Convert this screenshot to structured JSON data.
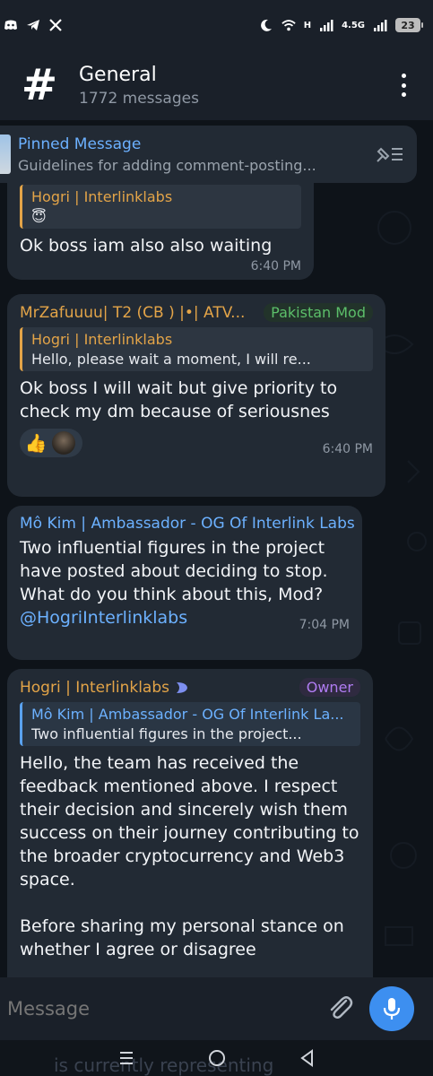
{
  "status_bar": {
    "icons": [
      "discord-icon",
      "telegram-icon",
      "x-icon"
    ],
    "right_icons": [
      "moon-icon",
      "wifi-icon",
      "signal-icon",
      "signal-4g-icon"
    ],
    "net_h": "H",
    "net_4g": "4.5G",
    "battery": "23"
  },
  "header": {
    "title": "General",
    "subtitle": "1772 messages",
    "icon": "hash-icon"
  },
  "pinned": {
    "title": "Pinned Message",
    "text": "Guidelines for adding comment-posting..."
  },
  "messages": [
    {
      "reply_name": "Hogri | Interlinklabs",
      "reply_emoji": "😇",
      "text": "Ok boss iam also also waiting",
      "time": "6:40 PM"
    },
    {
      "author": "MrZafuuuu| T2 (CB ) |•| ATV...",
      "badge": "Pakistan Mod",
      "reply_name": "Hogri | Interlinklabs",
      "reply_text": "Hello, please wait a moment, I will re...",
      "text": "Ok boss I will wait but give priority to check my dm because of seriousnes",
      "reaction": "👍",
      "time": "6:40 PM"
    },
    {
      "author": "Mô Kim | Ambassador - OG Of Interlink Labs",
      "text": "Two influential figures in the project have posted about deciding to stop. What do you think about this, Mod?",
      "mention": "@HogriInterlinklabs",
      "time": "7:04 PM"
    },
    {
      "author": "Hogri | Interlinklabs",
      "badge": "Owner",
      "reply_name": "Mô Kim | Ambassador - OG Of Interlink La...",
      "reply_text": "Two influential figures in the project...",
      "text": "Hello, the team has received the feedback mentioned above. I respect their decision and sincerely wish them success on their journey contributing to the broader cryptocurrency and Web3 space.",
      "text2": "Before sharing my personal stance on whether I agree or disagree"
    }
  ],
  "composer": {
    "placeholder": "Message"
  },
  "nav": {
    "ghost_text": "is currently representing"
  },
  "colors": {
    "accent": "#3d8ff0",
    "bubble": "#222a34",
    "reply_orange": "#e3a448",
    "link_blue": "#6cb1ff",
    "mod_green": "#5cbf6a",
    "owner_purple": "#b07cf2"
  }
}
